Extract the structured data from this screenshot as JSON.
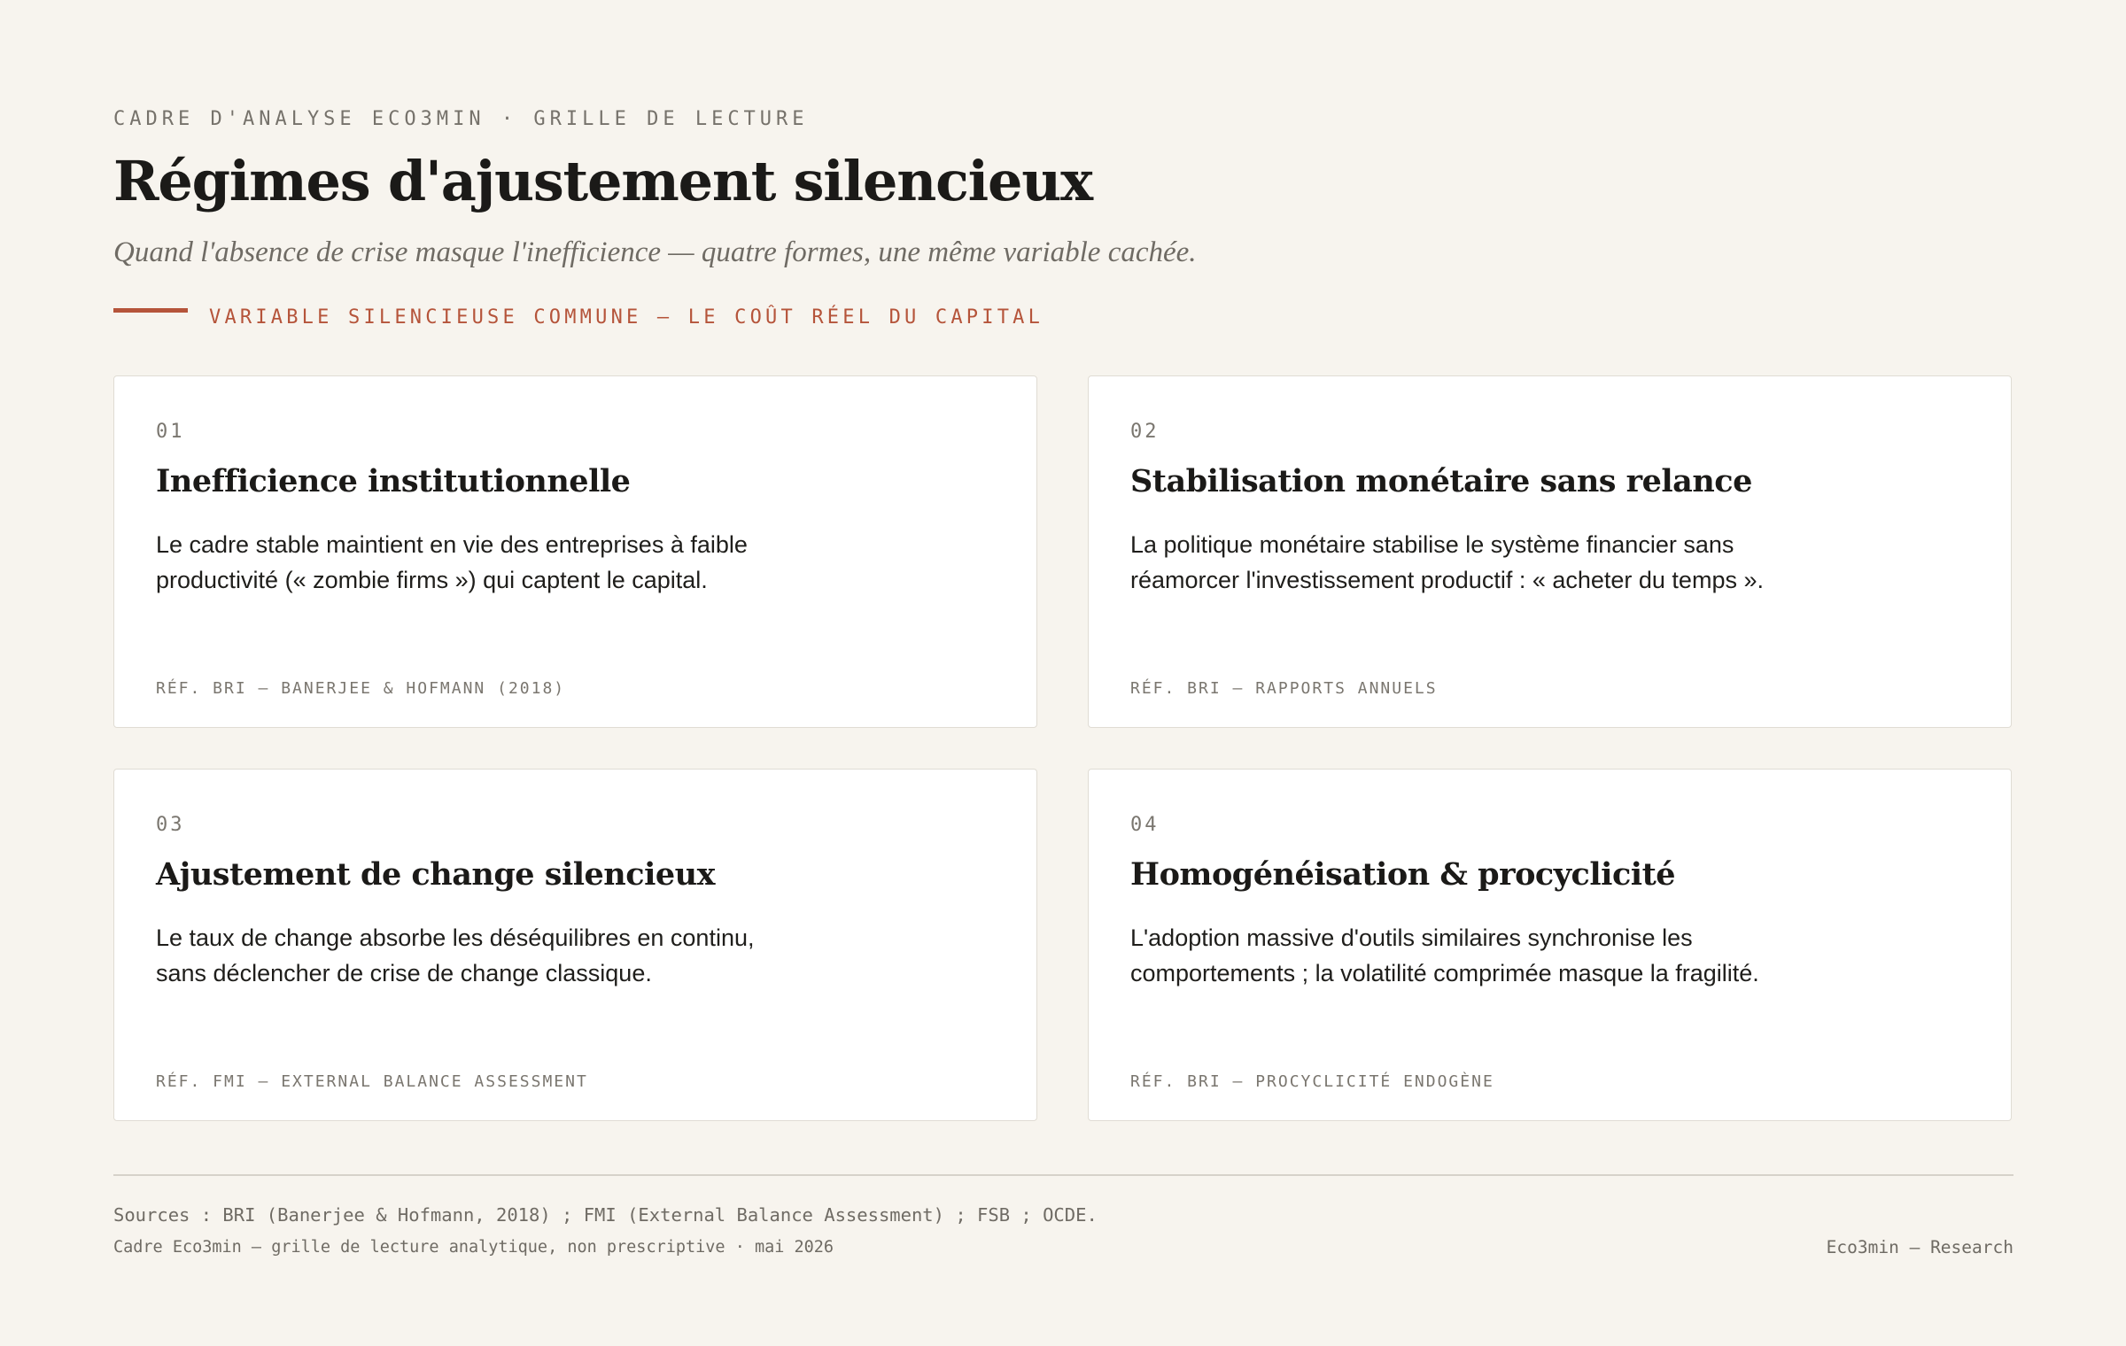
{
  "header": {
    "eyebrow": "CADRE D'ANALYSE ECO3MIN · GRILLE DE LECTURE",
    "title": "Régimes d'ajustement silencieux",
    "subtitle": "Quand l'absence de crise masque l'inefficience — quatre formes, une même variable cachée.",
    "accent_label": "VARIABLE SILENCIEUSE COMMUNE — LE COÛT RÉEL DU CAPITAL"
  },
  "cards": [
    {
      "num": "01",
      "title": "Inefficience institutionnelle",
      "body_line1": "Le cadre stable maintient en vie des entreprises à faible",
      "body_line2": "productivité (« zombie firms ») qui captent le capital.",
      "ref": "RÉF. BRI — BANERJEE & HOFMANN (2018)"
    },
    {
      "num": "02",
      "title": "Stabilisation monétaire sans relance",
      "body_line1": "La politique monétaire stabilise le système financier sans",
      "body_line2": "réamorcer l'investissement productif : « acheter du temps ».",
      "ref": "RÉF. BRI — RAPPORTS ANNUELS"
    },
    {
      "num": "03",
      "title": "Ajustement de change silencieux",
      "body_line1": "Le taux de change absorbe les déséquilibres en continu,",
      "body_line2": "sans déclencher de crise de change classique.",
      "ref": "RÉF. FMI — EXTERNAL BALANCE ASSESSMENT"
    },
    {
      "num": "04",
      "title": "Homogénéisation & procyclicité",
      "body_line1": "L'adoption massive d'outils similaires synchronise les",
      "body_line2": "comportements ; la volatilité comprimée masque la fragilité.",
      "ref": "RÉF. BRI — PROCYCLICITÉ ENDOGÈNE"
    }
  ],
  "footer": {
    "sources": "Sources : BRI (Banerjee & Hofmann, 2018) ; FMI (External Balance Assessment) ; FSB ; OCDE.",
    "meta": "Cadre Eco3min — grille de lecture analytique, non prescriptive · mai 2026",
    "brand": "Eco3min — Research"
  },
  "colors": {
    "background": "#f7f4ee",
    "accent": "#b5543a",
    "card": "#ffffff",
    "text": "#1b1a18",
    "muted": "#76726b"
  }
}
